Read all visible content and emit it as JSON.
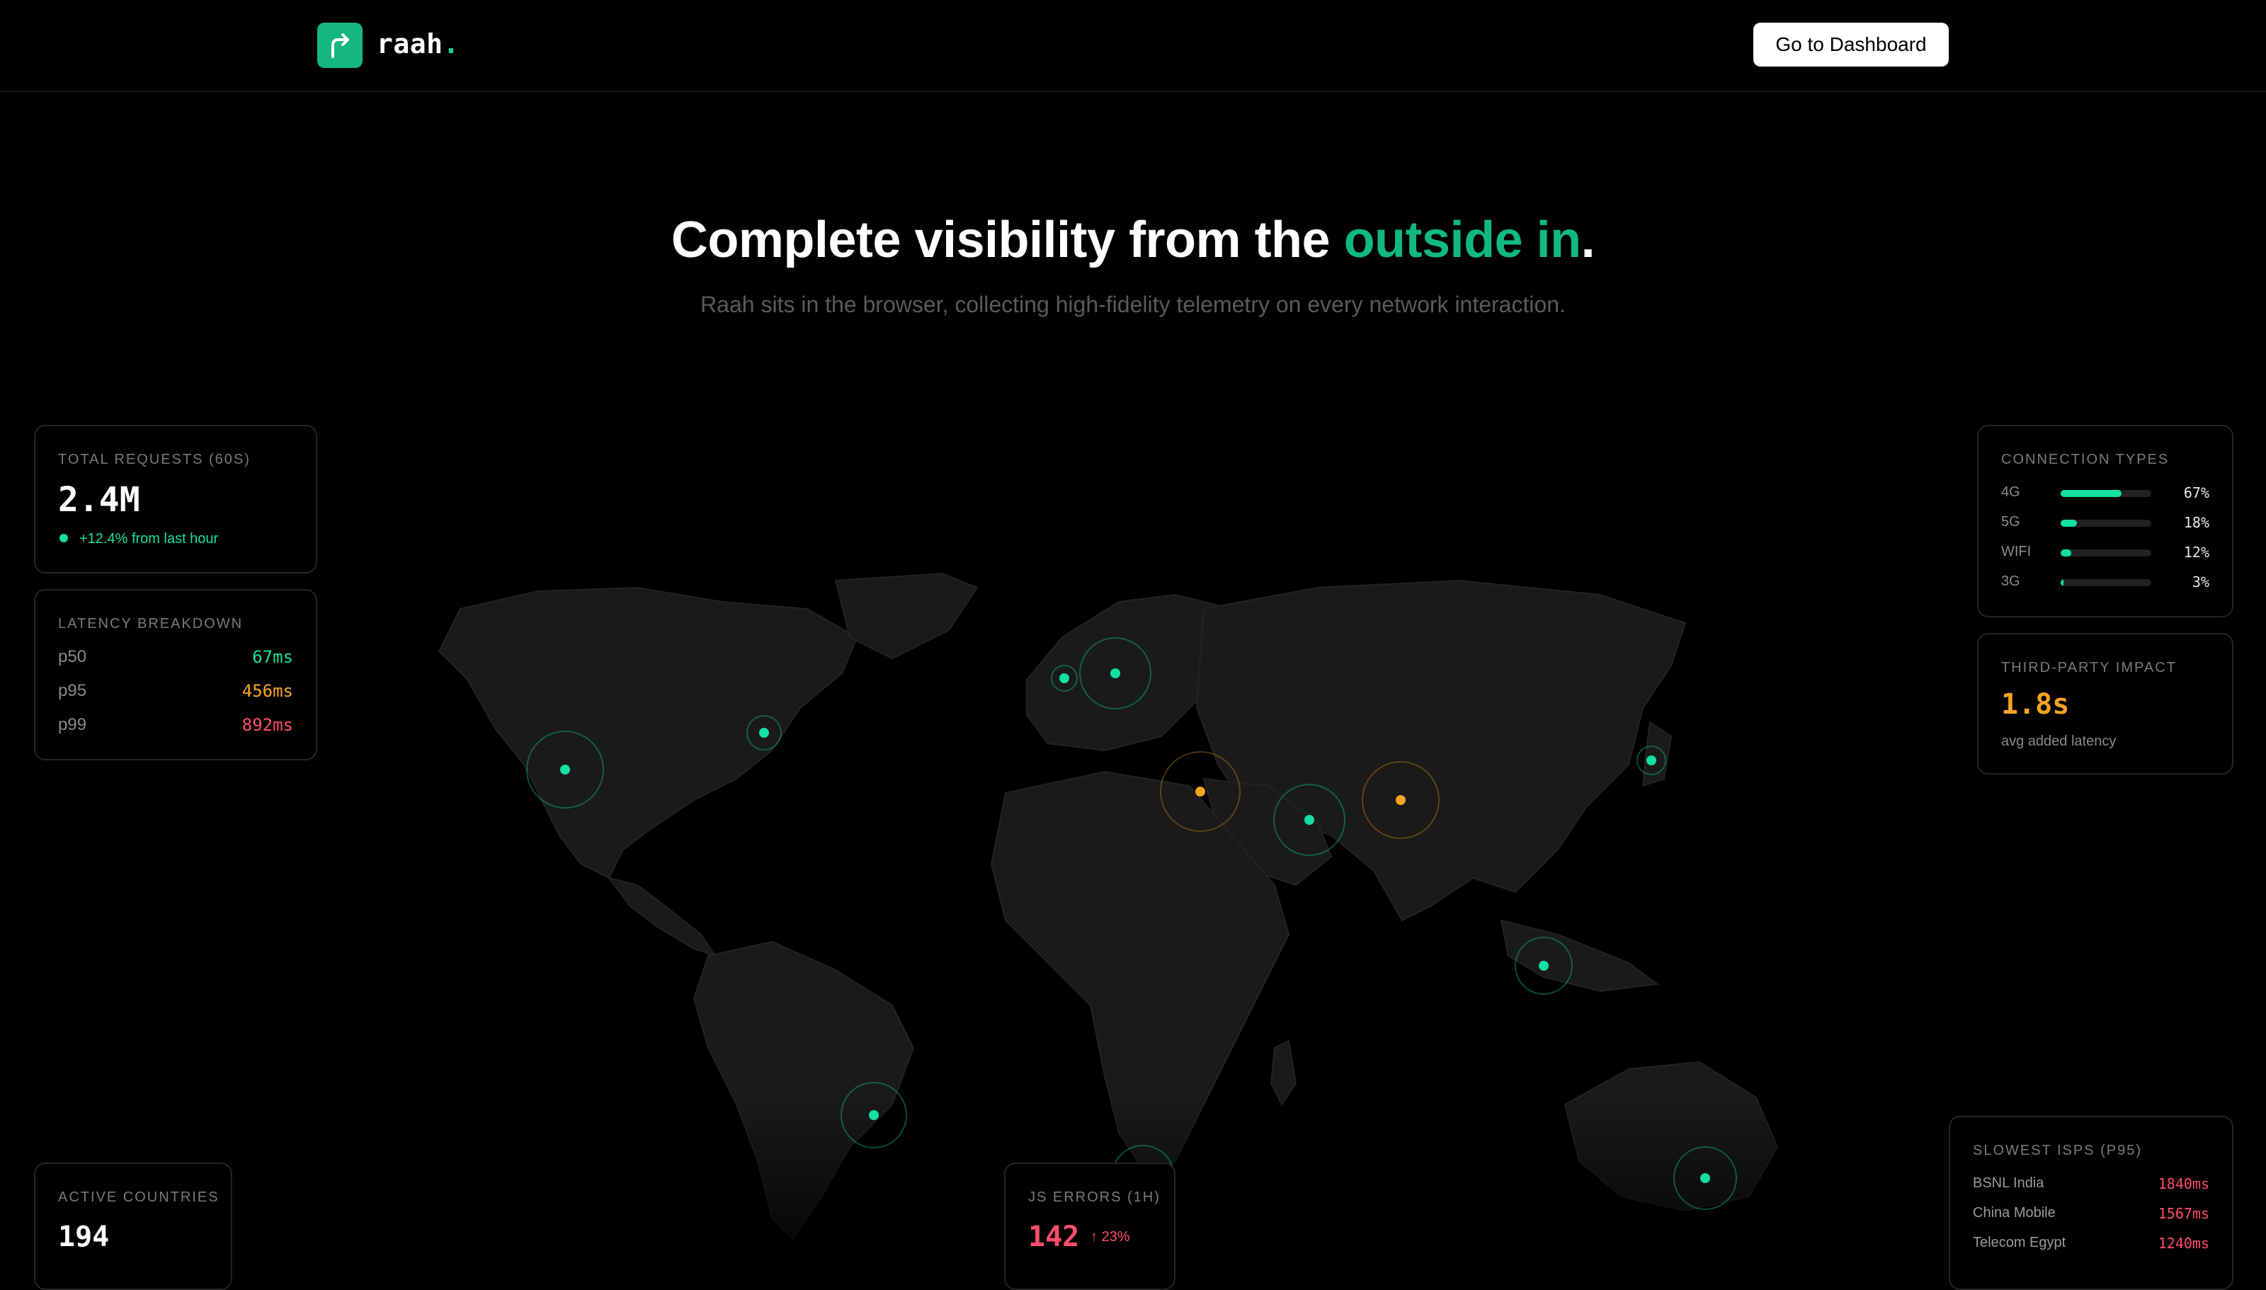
{
  "header": {
    "brand": "raah",
    "brand_dot": ".",
    "dashboard_button": "Go to Dashboard"
  },
  "hero": {
    "title_main": "Complete visibility from the ",
    "title_accent": "outside in",
    "title_end": ".",
    "subtitle": "Raah sits in the browser, collecting high-fidelity telemetry on every network interaction."
  },
  "cards": {
    "total_requests": {
      "label": "TOTAL REQUESTS (60S)",
      "value": "2.4M",
      "trend": "+12.4% from last hour"
    },
    "latency": {
      "label": "LATENCY BREAKDOWN",
      "rows": [
        {
          "name": "p50",
          "value": "67ms"
        },
        {
          "name": "p95",
          "value": "456ms"
        },
        {
          "name": "p99",
          "value": "892ms"
        }
      ]
    },
    "active_countries": {
      "label": "ACTIVE COUNTRIES",
      "value": "194"
    },
    "js_errors": {
      "label": "JS ERRORS (1H)",
      "value": "142",
      "delta": "↑ 23%"
    },
    "connection_types": {
      "label": "CONNECTION TYPES",
      "rows": [
        {
          "name": "4G",
          "value": "67%",
          "fraction": 0.67
        },
        {
          "name": "5G",
          "value": "18%",
          "fraction": 0.18
        },
        {
          "name": "WIFI",
          "value": "12%",
          "fraction": 0.12
        },
        {
          "name": "3G",
          "value": "3%",
          "fraction": 0.03
        }
      ]
    },
    "third_party": {
      "label": "THIRD-PARTY IMPACT",
      "value": "1.8s",
      "caption": "avg added latency"
    },
    "slowest_isps": {
      "label": "SLOWEST ISPS (P95)",
      "rows": [
        {
          "name": "BSNL India",
          "value": "1840ms"
        },
        {
          "name": "China Mobile",
          "value": "1567ms"
        },
        {
          "name": "Telecom Egypt",
          "value": "1240ms"
        }
      ]
    }
  },
  "colors": {
    "accent": "#10b981",
    "good": "#14e0a3",
    "warn": "#f5a524",
    "bad": "#ff4d6d"
  }
}
